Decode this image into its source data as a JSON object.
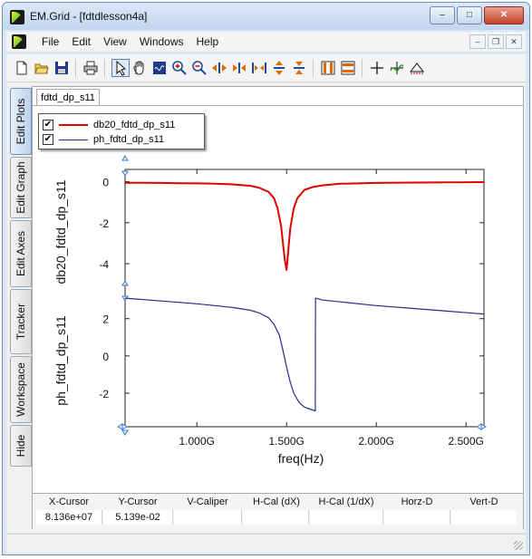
{
  "window": {
    "title": "EM.Grid - [fdtdlesson4a]"
  },
  "menu": [
    "File",
    "Edit",
    "View",
    "Windows",
    "Help"
  ],
  "side_tabs": [
    "Edit Plots",
    "Edit Graph",
    "Edit Axes",
    "Tracker",
    "Workspace",
    "Hide"
  ],
  "doc_tab": "fdtd_dp_s11",
  "legend": [
    {
      "label": "db20_fdtd_dp_s11",
      "color": "#e00000",
      "checked": true
    },
    {
      "label": "ph_fdtd_dp_s11",
      "color": "#2b2b8c",
      "checked": true
    }
  ],
  "chart_data": {
    "type": "line",
    "xlabel": "freq(Hz)",
    "xlim": [
      600000000,
      2600000000
    ],
    "xticks": [
      1000000000,
      1500000000,
      2000000000,
      2500000000
    ],
    "xticklabels": [
      "1.000G",
      "1.500G",
      "2.000G",
      "2.500G"
    ],
    "panels": [
      {
        "ylabel": "db20_fdtd_dp_s11",
        "ylim": [
          -5.5,
          0.6
        ],
        "yticks": [
          0,
          -2,
          -4
        ],
        "yticklabels": [
          "0",
          "-2",
          "-4"
        ],
        "series": [
          {
            "name": "db20_fdtd_dp_s11",
            "color": "#e00000",
            "x": [
              600000000,
              700000000,
              800000000,
              900000000,
              1000000000,
              1100000000,
              1200000000,
              1300000000,
              1350000000,
              1400000000,
              1430000000,
              1450000000,
              1470000000,
              1480000000,
              1490000000,
              1500000000,
              1510000000,
              1520000000,
              1540000000,
              1560000000,
              1600000000,
              1650000000,
              1700000000,
              1800000000,
              1900000000,
              2000000000,
              2200000000,
              2400000000,
              2600000000
            ],
            "y": [
              -0.05,
              -0.05,
              -0.06,
              -0.07,
              -0.08,
              -0.1,
              -0.13,
              -0.2,
              -0.3,
              -0.5,
              -0.8,
              -1.3,
              -2.2,
              -3.0,
              -3.8,
              -4.3,
              -3.3,
              -2.3,
              -1.3,
              -0.8,
              -0.4,
              -0.25,
              -0.18,
              -0.1,
              -0.08,
              -0.06,
              -0.04,
              -0.03,
              -0.02
            ]
          }
        ]
      },
      {
        "ylabel": "ph_fdtd_dp_s11",
        "ylim": [
          -3.8,
          3.3
        ],
        "yticks": [
          2,
          0,
          -2
        ],
        "yticklabels": [
          "2",
          "0",
          "-2"
        ],
        "series": [
          {
            "name": "ph_fdtd_dp_s11",
            "color": "#2b2b8c",
            "x": [
              600000000,
              800000000,
              1000000000,
              1100000000,
              1200000000,
              1300000000,
              1350000000,
              1400000000,
              1430000000,
              1460000000,
              1480000000,
              1500000000,
              1520000000,
              1540000000,
              1570000000,
              1600000000,
              1630000000,
              1660000000,
              1661000000,
              1700000000,
              1800000000,
              2000000000,
              2200000000,
              2400000000,
              2600000000
            ],
            "y": [
              3.1,
              2.95,
              2.8,
              2.7,
              2.6,
              2.45,
              2.3,
              2.05,
              1.7,
              1.1,
              0.3,
              -0.6,
              -1.4,
              -2.0,
              -2.5,
              -2.75,
              -2.85,
              -2.95,
              3.1,
              3.0,
              2.9,
              2.7,
              2.55,
              2.4,
              2.25
            ]
          }
        ]
      }
    ]
  },
  "cursor_table": {
    "headers": [
      "X-Cursor",
      "Y-Cursor",
      "V-Caliper",
      "H-Cal (dX)",
      "H-Cal (1/dX)",
      "Horz-D",
      "Vert-D"
    ],
    "values": [
      "8.136e+07",
      "5.139e-02",
      "",
      "",
      "",
      "",
      ""
    ]
  }
}
